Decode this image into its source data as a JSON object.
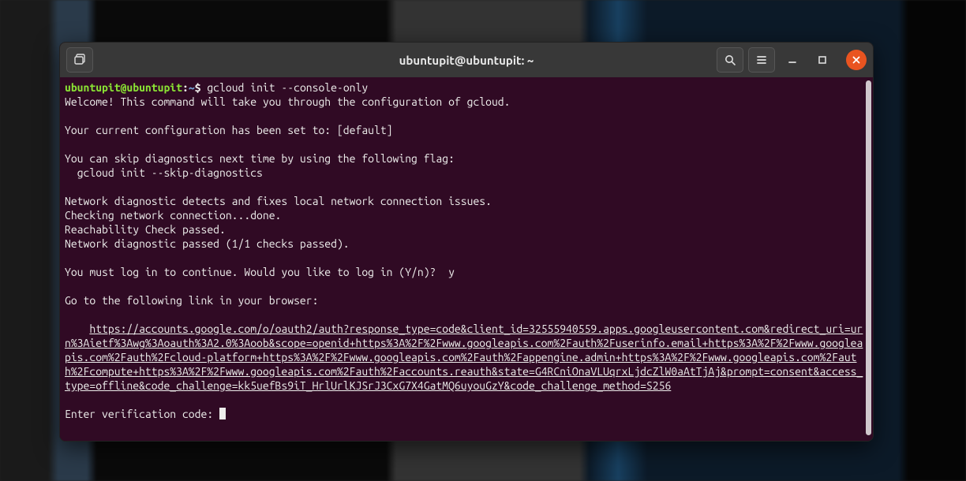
{
  "window": {
    "title": "ubuntupit@ubuntupit: ~"
  },
  "titlebar": {
    "newtab_icon": "new-tab-icon",
    "search_icon": "search-icon",
    "menu_icon": "hamburger-icon",
    "minimize_icon": "minimize-icon",
    "maximize_icon": "maximize-icon",
    "close_icon": "close-icon"
  },
  "prompt": {
    "user_host": "ubuntupit@ubuntupit",
    "path": "~",
    "symbol": "$",
    "command": "gcloud init --console-only"
  },
  "output": {
    "l1": "Welcome! This command will take you through the configuration of gcloud.",
    "blank1": "",
    "l2": "Your current configuration has been set to: [default]",
    "blank2": "",
    "l3": "You can skip diagnostics next time by using the following flag:",
    "l4": "  gcloud init --skip-diagnostics",
    "blank3": "",
    "l5": "Network diagnostic detects and fixes local network connection issues.",
    "l6": "Checking network connection...done.",
    "l7": "Reachability Check passed.",
    "l8": "Network diagnostic passed (1/1 checks passed).",
    "blank4": "",
    "l9": "You must log in to continue. Would you like to log in (Y/n)?  y",
    "blank5": "",
    "l10": "Go to the following link in your browser:",
    "blank6": "",
    "url_indent": "    ",
    "url": "https://accounts.google.com/o/oauth2/auth?response_type=code&client_id=32555940559.apps.googleusercontent.com&redirect_uri=urn%3Aietf%3Awg%3Aoauth%3A2.0%3Aoob&scope=openid+https%3A%2F%2Fwww.googleapis.com%2Fauth%2Fuserinfo.email+https%3A%2F%2Fwww.googleapis.com%2Fauth%2Fcloud-platform+https%3A%2F%2Fwww.googleapis.com%2Fauth%2Fappengine.admin+https%3A%2F%2Fwww.googleapis.com%2Fauth%2Fcompute+https%3A%2F%2Fwww.googleapis.com%2Fauth%2Faccounts.reauth&state=G4RCniOnaVLUqrxLjdcZlW0aAtTjAj&prompt=consent&access_type=offline&code_challenge=kk5uefBs9iT_HrlUrlKJSrJ3CxG7X4GatMQ6uyouGzY&code_challenge_method=S256",
    "blank7": "",
    "l12": "Enter verification code: "
  }
}
